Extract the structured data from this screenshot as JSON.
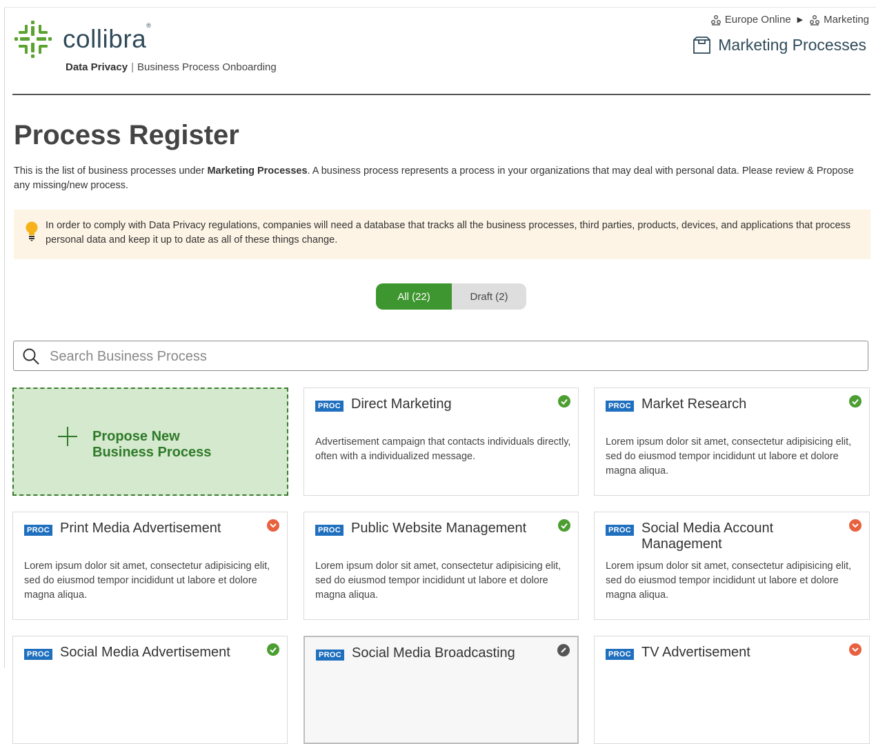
{
  "header": {
    "logo_text": "collibra",
    "logo_mark": "®",
    "subtitle_bold": "Data Privacy",
    "subtitle_sep": "|",
    "subtitle_rest": "Business Process Onboarding",
    "breadcrumb": [
      "Europe Online",
      "Marketing"
    ],
    "community_title": "Marketing Processes"
  },
  "page": {
    "title": "Process Register",
    "intro_part1": "This is the list of business processes under ",
    "intro_bold": "Marketing Processes",
    "intro_part2": ". A business process represents a process in your organizations that may deal with personal data. Please review & Propose any missing/new process.",
    "tip": "In order to comply with Data Privacy regulations, companies will need a database that tracks all the business processes, third parties, products, devices, and applications that process personal data and keep it up to date as all of these things change."
  },
  "filters": {
    "all_label": "All (22)",
    "draft_label": "Draft (2)",
    "active": "All (22)"
  },
  "search": {
    "placeholder": "Search Business Process",
    "value": ""
  },
  "propose": {
    "line1": "Propose New",
    "line2": "Business Process"
  },
  "colors": {
    "accent_green": "#3e9630",
    "proc_badge": "#1f6fbf",
    "status_ok": "#4c9e32",
    "status_warn": "#e8613f",
    "status_neutral": "#555555"
  },
  "cards": [
    {
      "badge": "PROC",
      "title": "Direct Marketing",
      "desc": "Advertisement campaign that contacts individuals directly, often with a individualized message.",
      "status": "ok"
    },
    {
      "badge": "PROC",
      "title": "Market Research",
      "desc": "Lorem ipsum dolor sit amet, consectetur adipisicing elit, sed do eiusmod tempor incididunt ut labore et dolore magna aliqua.",
      "status": "ok"
    },
    {
      "badge": "PROC",
      "title": "Print Media Advertisement",
      "desc": "Lorem ipsum dolor sit amet, consectetur adipisicing elit, sed do eiusmod tempor incididunt ut labore et dolore magna aliqua.",
      "status": "warn"
    },
    {
      "badge": "PROC",
      "title": "Public Website Management",
      "desc": "Lorem ipsum dolor sit amet, consectetur adipisicing elit, sed do eiusmod tempor incididunt ut labore et dolore magna aliqua.",
      "status": "ok"
    },
    {
      "badge": "PROC",
      "title": "Social Media Account Management",
      "desc": "Lorem ipsum dolor sit amet, consectetur adipisicing elit, sed do eiusmod tempor incididunt ut labore et dolore magna aliqua.",
      "status": "warn"
    },
    {
      "badge": "PROC",
      "title": "Social Media Advertisement",
      "desc": "",
      "status": "ok"
    },
    {
      "badge": "PROC",
      "title": "Social Media Broadcasting",
      "desc": "",
      "status": "neutral"
    },
    {
      "badge": "PROC",
      "title": "TV Advertisement",
      "desc": "",
      "status": "warn"
    }
  ]
}
